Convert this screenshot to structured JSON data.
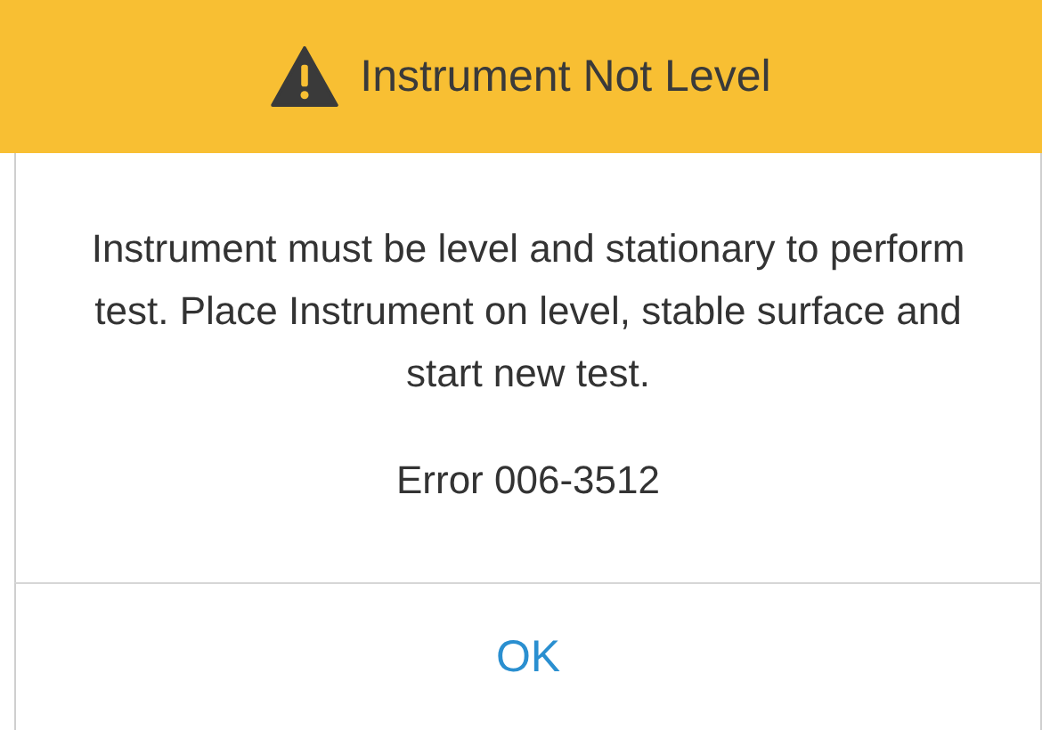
{
  "dialog": {
    "title": "Instrument Not Level",
    "message": "Instrument must be level and stationary to perform test. Place Instrument on level, stable surface and start new test.",
    "error_code": "Error 006-3512",
    "buttons": [
      "OK"
    ]
  }
}
